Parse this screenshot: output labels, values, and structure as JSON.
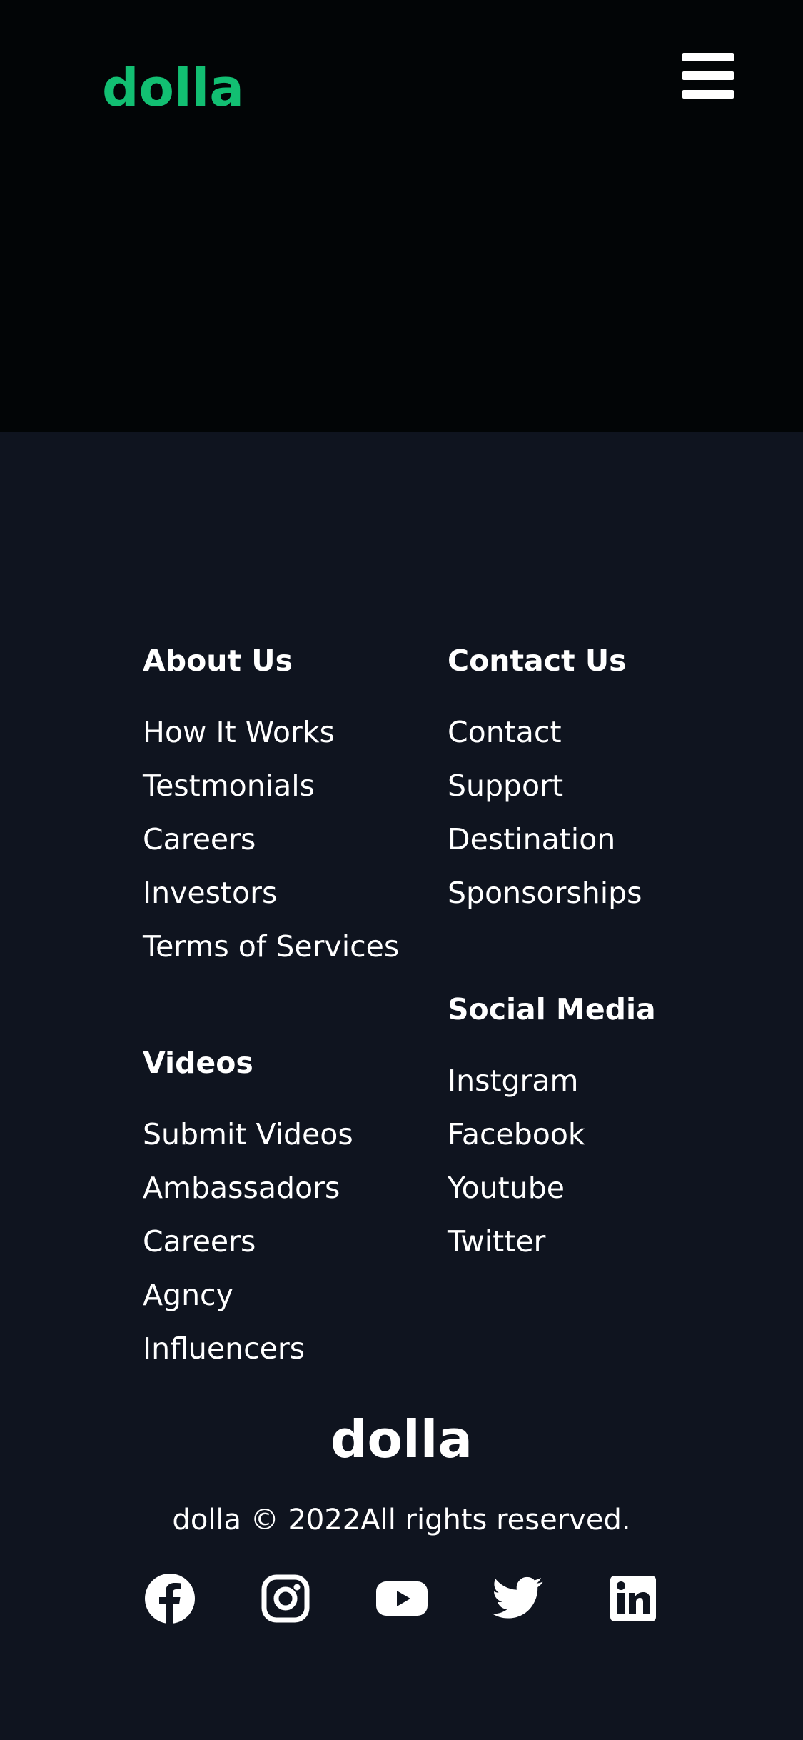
{
  "header": {
    "logo": "dolla",
    "menu_icon": "hamburger-menu-icon"
  },
  "footer": {
    "about": {
      "title": "About Us",
      "links": [
        "How It Works",
        "Testmonials",
        "Careers",
        "Investors",
        "Terms of Services"
      ]
    },
    "videos": {
      "title": "Videos",
      "links": [
        "Submit Videos",
        "Ambassadors",
        "Careers",
        "Agncy",
        "Influencers"
      ]
    },
    "contact": {
      "title": "Contact Us",
      "links": [
        "Contact",
        "Support",
        "Destination",
        "Sponsorships"
      ]
    },
    "social_media": {
      "title": "Social Media",
      "links": [
        "Instgram",
        "Facebook",
        "Youtube",
        "Twitter"
      ]
    },
    "logo": "dolla",
    "copyright": "dolla © 2022All rights reserved.",
    "social_icons": [
      "facebook-icon",
      "instagram-icon",
      "youtube-icon",
      "twitter-icon",
      "linkedin-icon"
    ]
  },
  "colors": {
    "brand": "#12bf72",
    "nav_bg": "#020506",
    "footer_bg": "#0f141f",
    "text": "#ffffff"
  }
}
